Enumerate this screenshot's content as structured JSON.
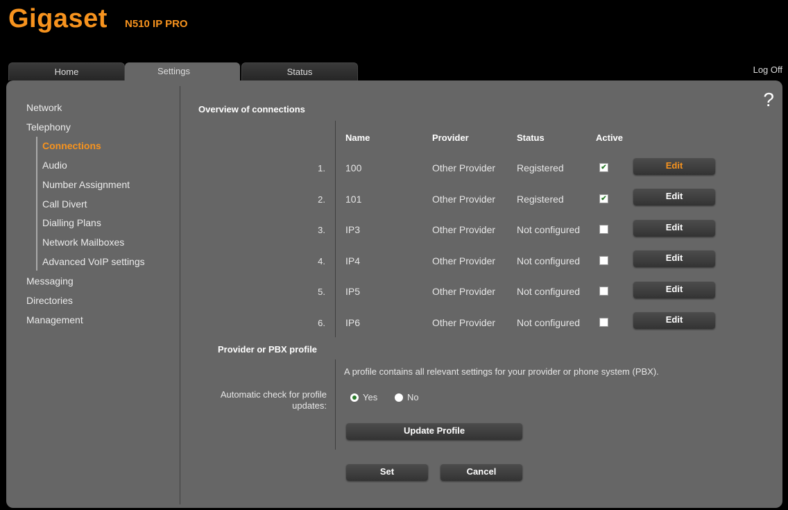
{
  "header": {
    "logo": "Gigaset",
    "model": "N510 IP PRO",
    "logoff": "Log Off"
  },
  "tabs": [
    {
      "label": "Home"
    },
    {
      "label": "Settings"
    },
    {
      "label": "Status"
    }
  ],
  "help": "?",
  "sidebar": {
    "network": "Network",
    "telephony": "Telephony",
    "sub": [
      "Connections",
      "Audio",
      "Number Assignment",
      "Call Divert",
      "Dialling Plans",
      "Network Mailboxes",
      "Advanced VoIP settings"
    ],
    "messaging": "Messaging",
    "directories": "Directories",
    "management": "Management"
  },
  "overview": {
    "title": "Overview of connections",
    "headers": {
      "name": "Name",
      "provider": "Provider",
      "status": "Status",
      "active": "Active"
    },
    "rows": [
      {
        "num": "1.",
        "name": "100",
        "provider": "Other Provider",
        "status": "Registered",
        "active": "✔",
        "edit": "Edit"
      },
      {
        "num": "2.",
        "name": "101",
        "provider": "Other Provider",
        "status": "Registered",
        "active": "✔",
        "edit": "Edit"
      },
      {
        "num": "3.",
        "name": "IP3",
        "provider": "Other Provider",
        "status": "Not configured",
        "active": "",
        "edit": "Edit"
      },
      {
        "num": "4.",
        "name": "IP4",
        "provider": "Other Provider",
        "status": "Not configured",
        "active": "",
        "edit": "Edit"
      },
      {
        "num": "5.",
        "name": "IP5",
        "provider": "Other Provider",
        "status": "Not configured",
        "active": "",
        "edit": "Edit"
      },
      {
        "num": "6.",
        "name": "IP6",
        "provider": "Other Provider",
        "status": "Not configured",
        "active": "",
        "edit": "Edit"
      }
    ]
  },
  "profile": {
    "title": "Provider or PBX profile",
    "description": "A profile contains all relevant settings for your provider or phone system (PBX).",
    "auto_check_line1": "Automatic check for profile",
    "auto_check_line2": "updates:",
    "yes": "Yes",
    "no": "No",
    "update_button": "Update Profile"
  },
  "actions": {
    "set": "Set",
    "cancel": "Cancel"
  },
  "colors": {
    "accent": "#f7931e",
    "panel": "#666666",
    "background": "#000000"
  }
}
